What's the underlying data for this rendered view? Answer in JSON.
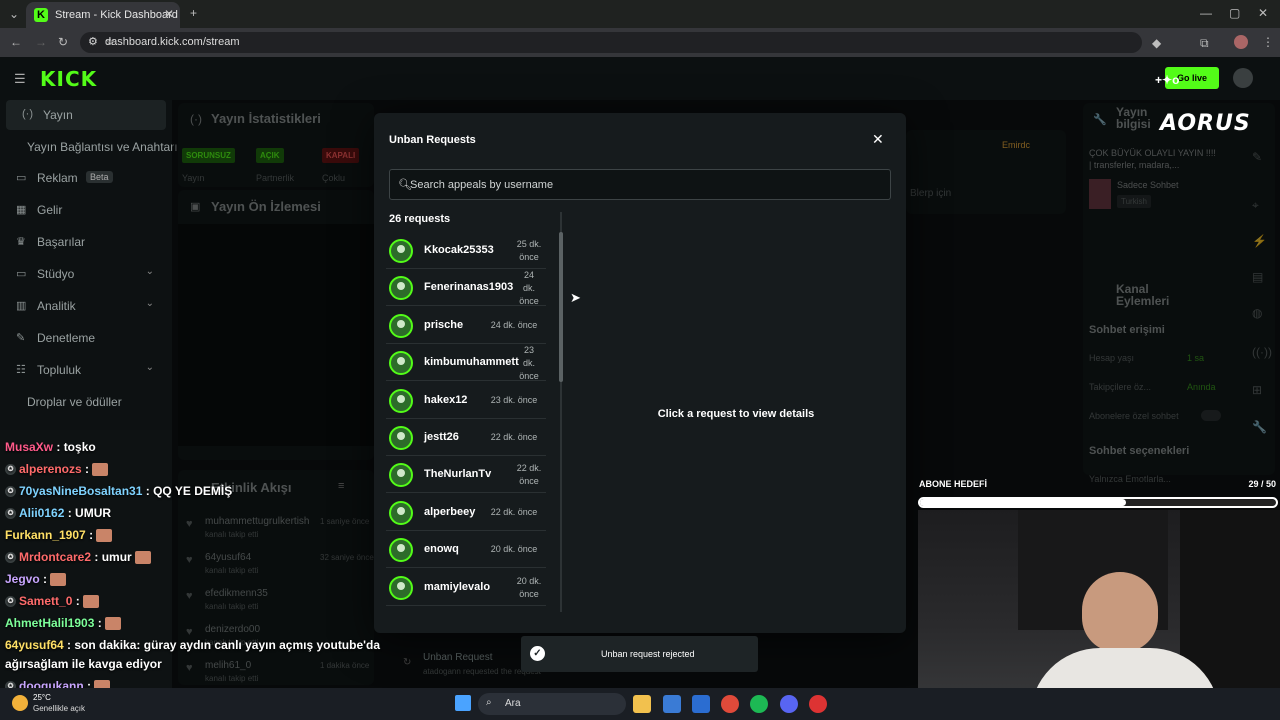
{
  "browser": {
    "tab_title": "Stream - Kick Dashboard",
    "url": "dashboard.kick.com/stream"
  },
  "site": {
    "logo": "KICK",
    "go_live": "Go live",
    "sidebar": [
      {
        "icon": "broadcast-icon",
        "label": "Yayın",
        "active": true
      },
      {
        "icon": "",
        "label": "Yayın Bağlantısı ve Anahtarı"
      },
      {
        "icon": "megaphone-icon",
        "label": "Reklam",
        "badge": "Beta"
      },
      {
        "icon": "dollar-icon",
        "label": "Gelir"
      },
      {
        "icon": "trophy-icon",
        "label": "Başarılar"
      },
      {
        "icon": "studio-icon",
        "label": "Stüdyo",
        "chevron": true
      },
      {
        "icon": "chart-icon",
        "label": "Analitik",
        "chevron": true
      },
      {
        "icon": "wrench-icon",
        "label": "Denetleme"
      },
      {
        "icon": "users-icon",
        "label": "Topluluk",
        "chevron": true
      },
      {
        "icon": "",
        "label": "Droplar ve ödüller"
      }
    ],
    "stats_title": "Yayın İstatistikleri",
    "stats_pills": [
      "SORUNSUZ",
      "AÇIK",
      "KAPALI"
    ],
    "stats_labels": [
      "Yayın",
      "Partnerlik",
      "Çoklu"
    ],
    "preview_title": "Yayın Ön İzlemesi",
    "activity_title": "Etkinlik Akışı",
    "activity": [
      {
        "name": "muhammettugrulkertish",
        "time": "1 saniye önce",
        "sub": "kanalı takip etti"
      },
      {
        "name": "64yusuf64",
        "time": "32 saniye önce",
        "sub": "kanalı takip etti"
      },
      {
        "name": "efedikmenn35",
        "time": "",
        "sub": "kanalı takip etti"
      },
      {
        "name": "denizerdo00",
        "time": "",
        "sub": "kanalı takip etti"
      },
      {
        "name": "melih61_0",
        "time": "1 dakika önce",
        "sub": "kanalı takip etti"
      }
    ],
    "unban_row": {
      "title": "Unban Request",
      "sub": "atadogann requested the request"
    },
    "mid_text": "Blerp için",
    "channel_tag": "Emirdc",
    "right_panel": {
      "info_title": "Yayın bilgisi",
      "stream_title": "ÇOK BÜYÜK OLAYLI YAYIN !!!! | transferler, madara,...",
      "category": "Sadece Sohbet",
      "language": "Turkish",
      "actions_title": "Kanal Eylemleri",
      "chat_access": "Sohbet erişimi",
      "account_age": "Hesap yaşı",
      "account_age_val": "1 sa",
      "followers_only": "Takipçilere öz...",
      "followers_only_val": "Anında",
      "subs_only": "Abonelere özel sohbet",
      "chat_options": "Sohbet seçenekleri",
      "emotes_only": "Yalnızca Emotlarla..."
    }
  },
  "modal": {
    "title": "Unban Requests",
    "search_placeholder": "Search appeals by username",
    "count": "26 requests",
    "hint": "Click a request to view details",
    "requests": [
      {
        "name": "Kkocak25353",
        "time": "25 dk.\nönce"
      },
      {
        "name": "Fenerinanas1903",
        "time": "24\ndk.\nönce"
      },
      {
        "name": "prische",
        "time": "24 dk. önce"
      },
      {
        "name": "kimbumuhammett",
        "time": "23\ndk.\nönce"
      },
      {
        "name": "hakex12",
        "time": "23 dk. önce"
      },
      {
        "name": "jestt26",
        "time": "22 dk. önce"
      },
      {
        "name": "TheNurlanTv",
        "time": "22 dk.\nönce"
      },
      {
        "name": "alperbeey",
        "time": "22 dk. önce"
      },
      {
        "name": "enowq",
        "time": "20 dk. önce"
      },
      {
        "name": "mamiylevalo",
        "time": "20 dk.\nönce"
      }
    ]
  },
  "toast": {
    "text": "Unban request rejected"
  },
  "chat_overlay": [
    {
      "user": "MusaXw",
      "color": "#ff5a8a",
      "msg": ": toşko",
      "emote": false,
      "badge": false
    },
    {
      "user": "alperenozs",
      "color": "#ff6b6b",
      "msg": ":",
      "emote": true,
      "badge": true
    },
    {
      "user": "70yasNineBosaltan31",
      "color": "#7fd3ff",
      "msg": ": QQ YE DEMİŞ",
      "emote": false,
      "badge": true
    },
    {
      "user": "Alii0162",
      "color": "#7fd3ff",
      "msg": ": UMUR",
      "emote": false,
      "badge": true
    },
    {
      "user": "Furkann_1907",
      "color": "#ffe066",
      "msg": ":",
      "emote": true,
      "badge": false
    },
    {
      "user": "Mrdontcare2",
      "color": "#ff6b6b",
      "msg": ": umur",
      "emote": true,
      "badge": true
    },
    {
      "user": "Jegvo",
      "color": "#c9a6ff",
      "msg": ":",
      "emote": true,
      "badge": false
    },
    {
      "user": "Samett_0",
      "color": "#ff6b6b",
      "msg": ":",
      "emote": true,
      "badge": true
    },
    {
      "user": "AhmetHalil1903",
      "color": "#7dff9a",
      "msg": ":",
      "emote": true,
      "badge": false
    },
    {
      "user": "64yusuf64",
      "color": "#ffe066",
      "msg": ": son dakika: güray aydın canlı yayın açmış youtube'da",
      "emote": false,
      "badge": false
    },
    {
      "user": "",
      "color": "#ffffff",
      "msg": "ağırsağlam ile kavga ediyor",
      "emote": false,
      "badge": false
    },
    {
      "user": "doogukann",
      "color": "#c9a6ff",
      "msg": ":",
      "emote": true,
      "badge": true
    }
  ],
  "subgoal": {
    "label": "ABONE HEDEFİ",
    "value": "29 / 50",
    "progress": 0.58
  },
  "brand": "AORUS",
  "taskbar": {
    "weather_temp": "25°C",
    "weather_desc": "Genellikle açık",
    "search": "Ara"
  }
}
